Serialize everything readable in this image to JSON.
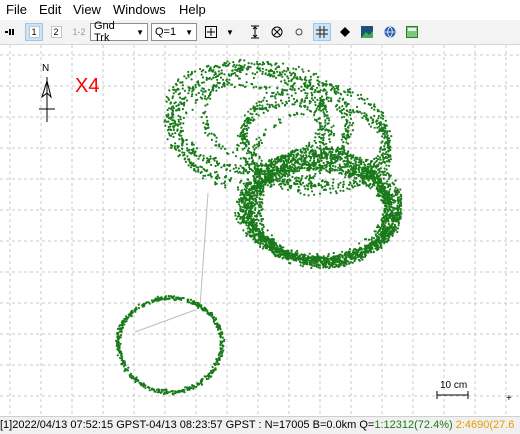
{
  "menu": [
    "File",
    "Edit",
    "View",
    "Windows",
    "Help"
  ],
  "toolbar": {
    "btn1": "1",
    "btn2": "2",
    "btn12": "1-2",
    "plot_type": "Gnd Trk",
    "quality": "Q=1"
  },
  "plot": {
    "north_label": "N",
    "overlay_label": "X4",
    "overlay_color": "#ff0000",
    "track_color": "#1a7a1a",
    "scale_label": "10 cm"
  },
  "status": {
    "text": "[1]2022/04/13 07:52:15 GPST-04/13 08:23:57 GPST : N=17005 B=0.0km Q=",
    "q1": "1:12312(72.4%)",
    "q1_color": "#1a7a1a",
    "q2": " 2:4690(27.6",
    "q2_color": "#e89a00"
  }
}
